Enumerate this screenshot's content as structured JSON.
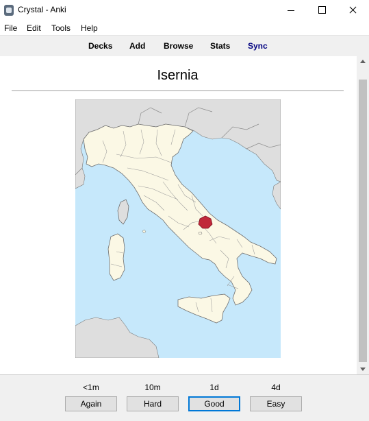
{
  "window": {
    "title": "Crystal - Anki"
  },
  "menu": {
    "items": [
      "File",
      "Edit",
      "Tools",
      "Help"
    ]
  },
  "toolbar": {
    "links": [
      "Decks",
      "Add",
      "Browse",
      "Stats",
      "Sync"
    ]
  },
  "card": {
    "title": "Isernia",
    "image": "map-of-italy-with-isernia-highlighted"
  },
  "colors": {
    "sea": "#c6e8fb",
    "land": "#fbf8e5",
    "neighbor": "#dedede",
    "highlight": "#c0283a",
    "sync_link": "#000080"
  },
  "answer_buttons": [
    {
      "interval": "<1m",
      "label": "Again"
    },
    {
      "interval": "10m",
      "label": "Hard"
    },
    {
      "interval": "1d",
      "label": "Good"
    },
    {
      "interval": "4d",
      "label": "Easy"
    }
  ]
}
